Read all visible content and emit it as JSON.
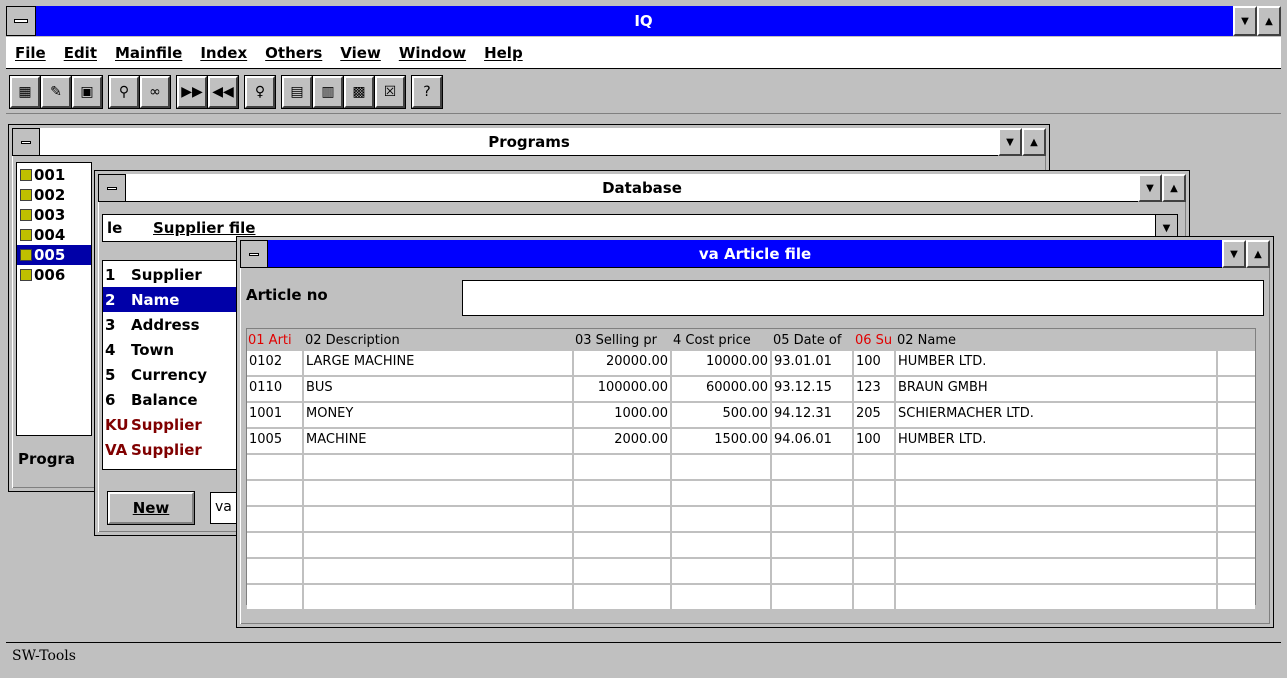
{
  "app": {
    "title": "IQ"
  },
  "menu": [
    "File",
    "Edit",
    "Mainfile",
    "Index",
    "Others",
    "View",
    "Window",
    "Help"
  ],
  "toolbar": {
    "groups": [
      [
        "calculator-icon",
        "edit-record-icon",
        "save-icon"
      ],
      [
        "search-icon",
        "find-glasses-icon"
      ],
      [
        "forward-icon",
        "rewind-icon"
      ],
      [
        "lightbulb-icon"
      ],
      [
        "window-split-icon",
        "window-cascade-icon",
        "window-close-all-icon",
        "window-delete-icon"
      ],
      [
        "help-icon"
      ]
    ]
  },
  "programs_window": {
    "title": "Programs",
    "items": [
      "001",
      "002",
      "003",
      "004",
      "005",
      "006"
    ],
    "selected": "005",
    "footer_label": "Progra"
  },
  "database_window": {
    "title": "Database",
    "selector_prefix": "le",
    "selector_value": "Supplier file",
    "fields": [
      {
        "num": "1",
        "name": "Supplier"
      },
      {
        "num": "2",
        "name": "Name"
      },
      {
        "num": "3",
        "name": "Address"
      },
      {
        "num": "4",
        "name": "Town"
      },
      {
        "num": "5",
        "name": "Currency"
      },
      {
        "num": "6",
        "name": "Balance"
      },
      {
        "num": "KU",
        "name": "Supplier"
      },
      {
        "num": "VA",
        "name": "Supplier"
      }
    ],
    "selected_field": "2",
    "new_button": "New",
    "bottom_field": "va"
  },
  "article_window": {
    "title": "va Article file",
    "key_label": "Article no",
    "key_value": "",
    "columns": [
      "01 Arti",
      "02 Description",
      "03 Selling pr",
      "4 Cost price",
      "05 Date of",
      "06 Su",
      "02 Name"
    ],
    "rows": [
      [
        "0102",
        "LARGE MACHINE",
        "20000.00",
        "10000.00",
        "93.01.01",
        "100",
        "HUMBER LTD."
      ],
      [
        "0110",
        "BUS",
        "100000.00",
        "60000.00",
        "93.12.15",
        "123",
        "BRAUN GMBH"
      ],
      [
        "1001",
        "MONEY",
        "1000.00",
        "500.00",
        "94.12.31",
        "205",
        "SCHIERMACHER LTD."
      ],
      [
        "1005",
        "MACHINE",
        "2000.00",
        "1500.00",
        "94.06.01",
        "100",
        "HUMBER LTD."
      ]
    ],
    "empty_rows": 6
  },
  "status": {
    "text": "SW-Tools"
  },
  "colors": {
    "title_active": "#0000ff",
    "selection": "#0000a8",
    "desktop": "#c0c0c0",
    "red_header": "#e00000"
  }
}
